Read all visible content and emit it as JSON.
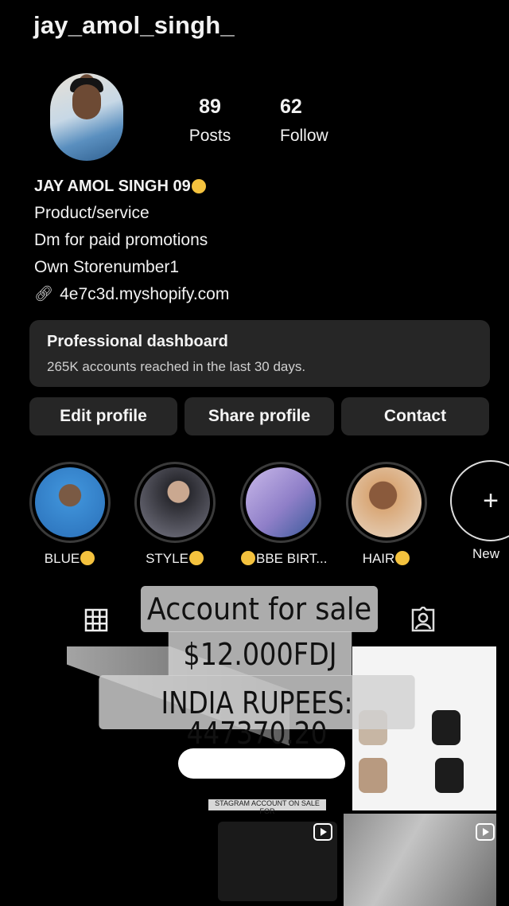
{
  "profile": {
    "username": "jay_amol_singh_",
    "posts_count": "89",
    "posts_label": "Posts",
    "followers_count": "62",
    "followers_label": "Follow",
    "display_name": "JAY AMOL SINGH 09",
    "category": "Product/service",
    "bio_line1": "Dm for paid promotions",
    "bio_line2": "Own Storenumber1",
    "website": "4e7c3d.myshopify.com"
  },
  "dashboard": {
    "title": "Professional dashboard",
    "subtitle": "265K accounts reached in the last 30 days."
  },
  "buttons": {
    "edit": "Edit profile",
    "share": "Share profile",
    "contact": "Contact"
  },
  "highlights": [
    {
      "label": "BLUE",
      "color": "#3d8fd6"
    },
    {
      "label": "STYLE",
      "color": "#7a7a88"
    },
    {
      "label": "BBE BIRT...",
      "color": "#8f7fc8"
    },
    {
      "label": "HAIR",
      "color": "#d9a878"
    },
    {
      "label": "New",
      "color": "#000000"
    }
  ],
  "overlay": {
    "line1": "Account for sale",
    "line2": "$12.000FDJ",
    "line3": "INDIA RUPEES: 447370.20"
  },
  "thumb_text": "STAGRAM ACCOUNT ON SALE FOR",
  "icons": [
    "grid-icon",
    "tagged-icon",
    "link-icon",
    "reel-icon",
    "plus-icon"
  ]
}
